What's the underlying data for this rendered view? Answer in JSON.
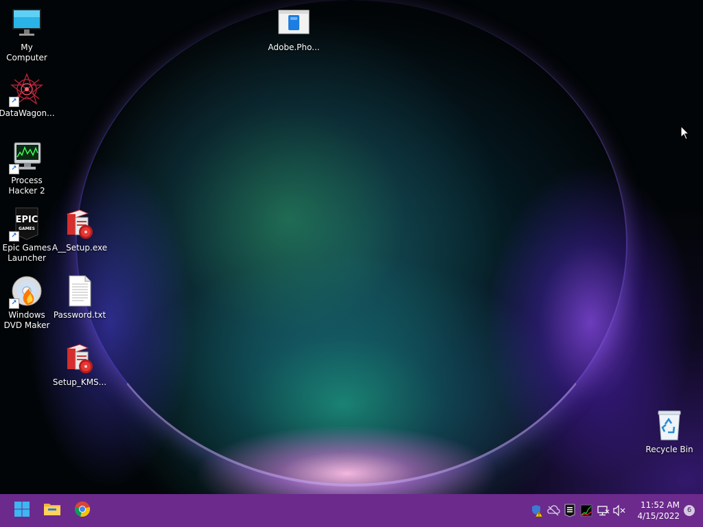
{
  "desktop": {
    "icons": {
      "my_computer": "My Computer",
      "adobe": "Adobe.Pho...",
      "datawagon": "DataWagon...",
      "process_hacker_line1": "Process",
      "process_hacker_line2": "Hacker 2",
      "epic_line1": "Epic Games",
      "epic_line2": "Launcher",
      "a_setup": "A__Setup.exe",
      "dvd_line1": "Windows",
      "dvd_line2": "DVD Maker",
      "password": "Password.txt",
      "setup_kms": "Setup_KMS...",
      "recycle_bin": "Recycle Bin"
    },
    "epic_logo_text": "EPIC",
    "epic_logo_sub": "GAMES"
  },
  "taskbar": {
    "pinned": [
      "start-icon",
      "file-explorer-icon",
      "chrome-icon"
    ],
    "tray_icons": [
      "defender-warning-icon",
      "onedrive-offline-icon",
      "epic-games-tray-icon",
      "process-hacker-tray-icon",
      "network-icon",
      "volume-muted-icon"
    ],
    "clock_time": "11:52 AM",
    "clock_date": "4/15/2022",
    "notification_count": "6",
    "color": "#6b2a8c"
  }
}
